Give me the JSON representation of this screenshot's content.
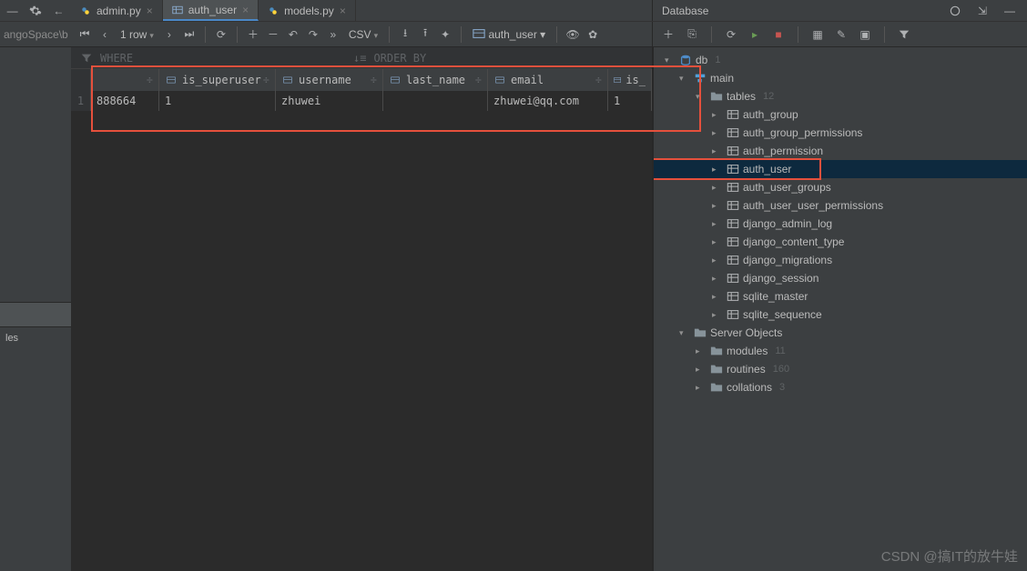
{
  "topbar": {
    "tabs": [
      {
        "label": "admin.py",
        "type": "python",
        "active": false
      },
      {
        "label": "auth_user",
        "type": "table",
        "active": true
      },
      {
        "label": "models.py",
        "type": "python",
        "active": false
      }
    ]
  },
  "breadcrumb": "angoSpace\\b",
  "db_panel_title": "Database",
  "toolbar_main": {
    "rows_label": "1 row",
    "csv_label": "CSV",
    "target_label": "auth_user"
  },
  "filter": {
    "where_label": "WHERE",
    "order_label": "ORDER BY"
  },
  "grid": {
    "columns": [
      "is_superuser",
      "username",
      "last_name",
      "email",
      "is_"
    ],
    "row_num": "1",
    "row": {
      "left_frag": "888664",
      "is_superuser": "1",
      "username": "zhuwei",
      "last_name": "",
      "email": "zhuwei@qq.com",
      "trail": "1"
    }
  },
  "tree": {
    "root": {
      "label": "db",
      "badge": "1"
    },
    "schema": "main",
    "tables_node": {
      "label": "tables",
      "badge": "12"
    },
    "tables": [
      "auth_group",
      "auth_group_permissions",
      "auth_permission",
      "auth_user",
      "auth_user_groups",
      "auth_user_user_permissions",
      "django_admin_log",
      "django_content_type",
      "django_migrations",
      "django_session",
      "sqlite_master",
      "sqlite_sequence"
    ],
    "selected_table": "auth_user",
    "server_objects": "Server Objects",
    "modules": {
      "label": "modules",
      "badge": "11"
    },
    "routines": {
      "label": "routines",
      "badge": "160"
    },
    "collations": {
      "label": "collations",
      "badge": "3"
    }
  },
  "sidetab": "les",
  "watermark": "CSDN @搞IT的放牛娃"
}
